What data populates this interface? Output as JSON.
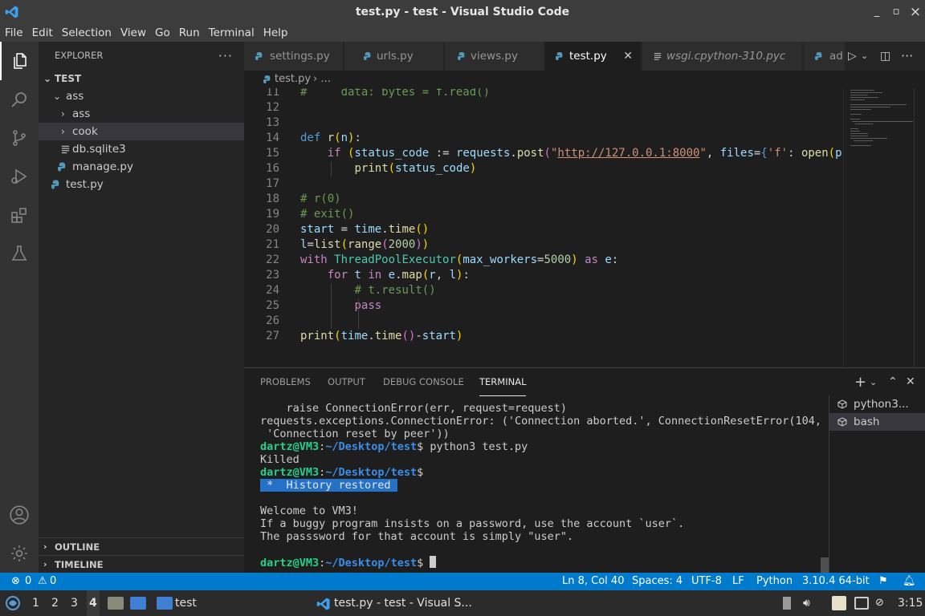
{
  "window": {
    "title": "test.py - test - Visual Studio Code"
  },
  "window_controls": {
    "minimize": "_",
    "restore": "▫",
    "close": "×"
  },
  "menu": [
    "File",
    "Edit",
    "Selection",
    "View",
    "Go",
    "Run",
    "Terminal",
    "Help"
  ],
  "activity_bar": [
    "explorer-icon",
    "search-icon",
    "source-control-icon",
    "run-debug-icon",
    "extensions-icon",
    "testing-icon",
    "account-icon",
    "settings-gear-icon"
  ],
  "sidebar": {
    "header": "EXPLORER",
    "more": "···",
    "root": "TEST",
    "tree": [
      {
        "label": "ass",
        "type": "folder",
        "expanded": true
      },
      {
        "label": "ass",
        "type": "folder",
        "expanded": false
      },
      {
        "label": "cook",
        "type": "folder",
        "expanded": false,
        "selected": true
      },
      {
        "label": "db.sqlite3",
        "type": "file"
      },
      {
        "label": "manage.py",
        "type": "python"
      },
      {
        "label": "test.py",
        "type": "python"
      }
    ],
    "outline": "OUTLINE",
    "timeline": "TIMELINE"
  },
  "tabs": [
    {
      "label": "settings.py"
    },
    {
      "label": "urls.py"
    },
    {
      "label": "views.py"
    },
    {
      "label": "test.py",
      "active": true
    },
    {
      "label": "wsgi.cpython-310.pyc",
      "italic": true
    },
    {
      "label": "ad"
    }
  ],
  "breadcrumb": {
    "file": "test.py",
    "sep": " › ..."
  },
  "editor": {
    "line_numbers": [
      "11",
      "12",
      "13",
      "14",
      "15",
      "16",
      "17",
      "18",
      "19",
      "20",
      "21",
      "22",
      "23",
      "24",
      "25",
      "26",
      "27"
    ],
    "code": [
      "#     data: bytes = f.read()",
      "",
      "",
      "def r(n):",
      "    if (status_code := requests.post(\"http://127.0.0.1:8000\", files={'f': open(p",
      "        print(status_code)",
      "",
      "# r(0)",
      "# exit()",
      "start = time.time()",
      "l=list(range(2000))",
      "with ThreadPoolExecutor(max_workers=5000) as e:",
      "    for t in e.map(r, l):",
      "        # t.result()",
      "        pass",
      "",
      "print(time.time()-start)"
    ]
  },
  "panel": {
    "tabs": [
      "PROBLEMS",
      "OUTPUT",
      "DEBUG CONSOLE",
      "TERMINAL"
    ],
    "active_tab": "TERMINAL",
    "terminal_lines": [
      {
        "text": "    raise ConnectionError(err, request=request)"
      },
      {
        "text": "requests.exceptions.ConnectionError: ('Connection aborted.', ConnectionResetError(104,"
      },
      {
        "text": " 'Connection reset by peer'))"
      },
      {
        "user": "dartz@VM3",
        "path": "~/Desktop/test",
        "cmd": "$ python3 test.py"
      },
      {
        "text": "Killed"
      },
      {
        "user": "dartz@VM3",
        "path": "~/Desktop/test",
        "cmd": "$"
      },
      {
        "highlight": " *  History restored "
      },
      {
        "text": ""
      },
      {
        "text": "Welcome to VM3!"
      },
      {
        "text": "If a buggy program insists on a password, use the account `user`."
      },
      {
        "text": "The passsword for that account is simply \"user\"."
      },
      {
        "text": ""
      },
      {
        "user": "dartz@VM3",
        "path": "~/Desktop/test",
        "cmd": "$ ",
        "cursor": true
      }
    ],
    "terminals": [
      {
        "label": "python3..."
      },
      {
        "label": "bash",
        "selected": true
      }
    ]
  },
  "statusbar": {
    "errors": "0",
    "warnings": "0",
    "position": "Ln 8, Col 40",
    "spaces": "Spaces: 4",
    "encoding": "UTF-8",
    "eol": "LF",
    "language": "Python",
    "interpreter": "3.10.4 64-bit"
  },
  "taskbar": {
    "workspaces": [
      "1",
      "2",
      "3",
      "4"
    ],
    "active_workspace": "4",
    "folder": "test",
    "window": "test.py - test - Visual S...",
    "clock": "3:15"
  },
  "colors": {
    "accent": "#007acc",
    "prompt_user": "#23d18b",
    "prompt_path": "#3b8eea"
  }
}
